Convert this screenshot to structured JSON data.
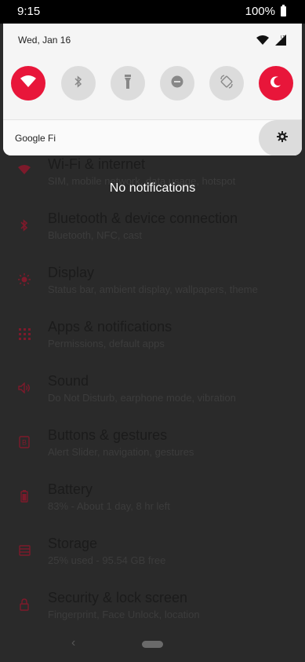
{
  "status_bar": {
    "time": "9:15",
    "battery": "100%"
  },
  "shade": {
    "date": "Wed, Jan 16",
    "carrier": "Google Fi",
    "tiles": [
      {
        "name": "wifi",
        "state": "on"
      },
      {
        "name": "bluetooth",
        "state": "off"
      },
      {
        "name": "flashlight",
        "state": "off"
      },
      {
        "name": "do-not-disturb",
        "state": "off"
      },
      {
        "name": "auto-rotate",
        "state": "off"
      },
      {
        "name": "night-mode",
        "state": "on"
      }
    ],
    "accent": "#e8163a"
  },
  "empty_state": "No notifications",
  "settings": [
    {
      "title": "Wi-Fi & internet",
      "subtitle": "SIM, mobile network, data usage, hotspot",
      "icon": "wifi-icon"
    },
    {
      "title": "Bluetooth & device connection",
      "subtitle": "Bluetooth, NFC, cast",
      "icon": "bluetooth-icon"
    },
    {
      "title": "Display",
      "subtitle": "Status bar, ambient display, wallpapers, theme",
      "icon": "brightness-icon"
    },
    {
      "title": "Apps & notifications",
      "subtitle": "Permissions, default apps",
      "icon": "apps-grid-icon"
    },
    {
      "title": "Sound",
      "subtitle": "Do Not Disturb, earphone mode, vibration",
      "icon": "speaker-icon"
    },
    {
      "title": "Buttons & gestures",
      "subtitle": "Alert Slider, navigation, gestures",
      "icon": "buttons-icon"
    },
    {
      "title": "Battery",
      "subtitle": "83% - About 1 day, 8 hr left",
      "icon": "battery-icon"
    },
    {
      "title": "Storage",
      "subtitle": "25% used - 95.54 GB free",
      "icon": "storage-icon"
    },
    {
      "title": "Security & lock screen",
      "subtitle": "Fingerprint, Face Unlock, location",
      "icon": "lock-icon"
    }
  ]
}
